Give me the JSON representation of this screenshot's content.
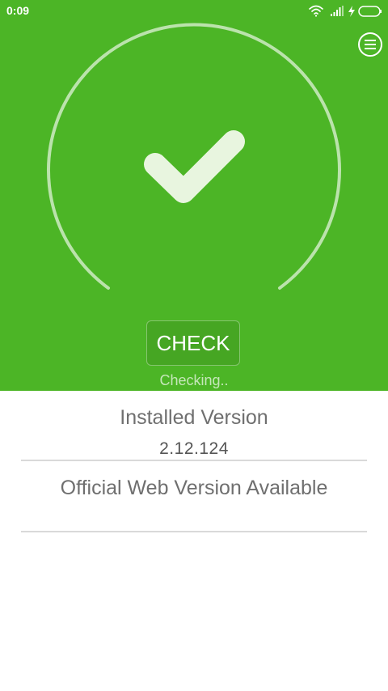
{
  "status_bar": {
    "time": "0:09",
    "icons": [
      "wifi-icon",
      "signal-icon",
      "charging-icon",
      "battery-icon"
    ]
  },
  "header": {
    "menu_icon": "hamburger-icon"
  },
  "status_panel": {
    "check_button_label": "CHECK",
    "checking_text": "Checking..",
    "status_icon": "check-mark-icon"
  },
  "version_info": {
    "installed_label": "Installed Version",
    "installed_value": "2.12.124",
    "official_label": "Official Web Version Available",
    "official_value": ""
  },
  "colors": {
    "primary_green": "#4cb526",
    "white": "#ffffff",
    "text_gray": "#6f6f6f"
  }
}
